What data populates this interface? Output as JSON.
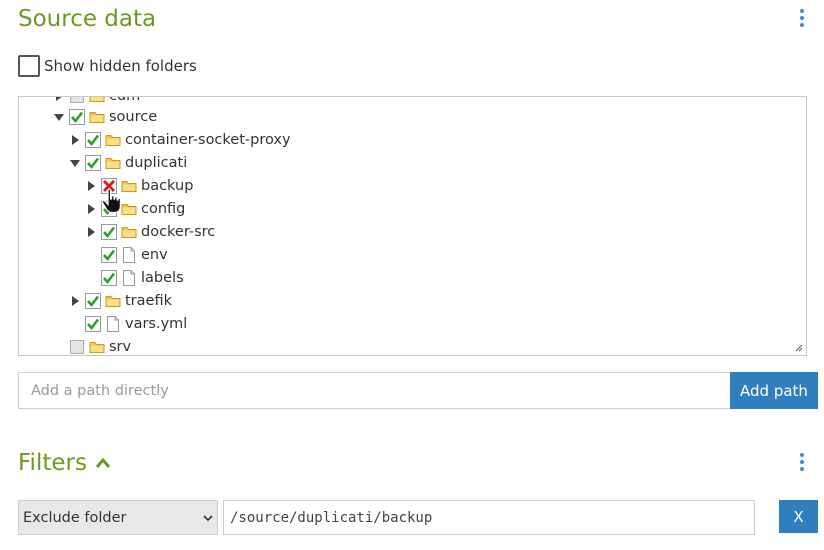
{
  "source_section": {
    "title": "Source data",
    "menu_icon": "kebab-menu-icon",
    "show_hidden": {
      "label": "Show hidden folders",
      "checked": false
    }
  },
  "tree": {
    "rows": [
      {
        "name": "tree-row-clipped",
        "label": "cdm",
        "expander": "collapsed",
        "check": "empty",
        "icon": "folder-icon"
      },
      {
        "name": "tree-row-source",
        "label": "source",
        "expander": "expanded",
        "check": "checked",
        "icon": "folder-icon"
      },
      {
        "name": "tree-row-container-socket-proxy",
        "label": "container-socket-proxy",
        "expander": "collapsed",
        "check": "checked",
        "icon": "folder-icon"
      },
      {
        "name": "tree-row-duplicati",
        "label": "duplicati",
        "expander": "expanded",
        "check": "checked",
        "icon": "folder-icon"
      },
      {
        "name": "tree-row-backup",
        "label": "backup",
        "expander": "collapsed",
        "check": "excluded",
        "icon": "folder-icon"
      },
      {
        "name": "tree-row-config",
        "label": "config",
        "expander": "collapsed",
        "check": "checked",
        "icon": "folder-icon"
      },
      {
        "name": "tree-row-docker-src",
        "label": "docker-src",
        "expander": "collapsed",
        "check": "checked",
        "icon": "folder-icon"
      },
      {
        "name": "tree-row-env",
        "label": "env",
        "expander": "none",
        "check": "checked",
        "icon": "file-icon"
      },
      {
        "name": "tree-row-labels",
        "label": "labels",
        "expander": "none",
        "check": "checked",
        "icon": "file-icon"
      },
      {
        "name": "tree-row-traefik",
        "label": "traefik",
        "expander": "collapsed",
        "check": "checked",
        "icon": "folder-icon"
      },
      {
        "name": "tree-row-vars-yml",
        "label": "vars.yml",
        "expander": "none",
        "check": "checked",
        "icon": "file-icon"
      },
      {
        "name": "tree-row-srv",
        "label": "srv",
        "expander": "none",
        "check": "empty",
        "icon": "folder-icon"
      }
    ]
  },
  "add_path": {
    "placeholder": "Add a path directly",
    "button_label": "Add path"
  },
  "filters_section": {
    "title": "Filters",
    "toggle_icon": "chevron-up-icon",
    "menu_icon": "kebab-menu-icon",
    "filter": {
      "type_label": "Exclude folder",
      "value": "/source/duplicati/backup",
      "remove_label": "X"
    }
  },
  "colors": {
    "accent_green": "#6a9a1f",
    "primary_blue": "#2f7fbf",
    "check_green": "#2aa02a",
    "exclude_red": "#d42020",
    "folder_yellow": "#f2c54a"
  }
}
